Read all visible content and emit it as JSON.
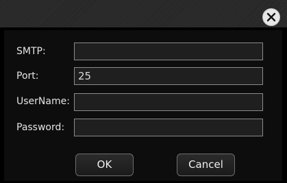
{
  "dialog": {
    "fields": {
      "smtp": {
        "label": "SMTP:",
        "value": ""
      },
      "port": {
        "label": "Port:",
        "value": "25"
      },
      "username": {
        "label": "UserName:",
        "value": ""
      },
      "password": {
        "label": "Password:",
        "value": ""
      }
    },
    "buttons": {
      "ok_label": "OK",
      "cancel_label": "Cancel"
    },
    "icons": {
      "close": "close-icon"
    }
  }
}
